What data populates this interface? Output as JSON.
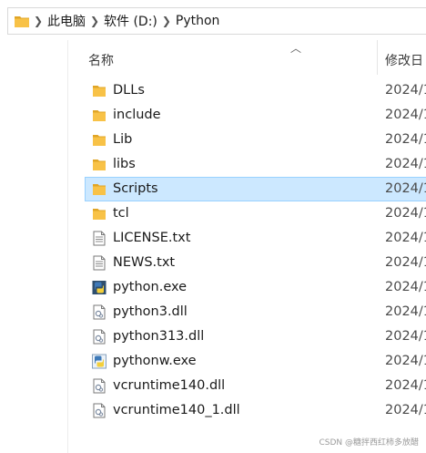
{
  "address": {
    "crumbs": [
      "此电脑",
      "软件 (D:)",
      "Python"
    ]
  },
  "header": {
    "name_label": "名称",
    "date_label": "修改日"
  },
  "files": [
    {
      "name": "DLLs",
      "date": "2024/1",
      "icon": "folder-icon",
      "selected": false
    },
    {
      "name": "include",
      "date": "2024/1",
      "icon": "folder-icon",
      "selected": false
    },
    {
      "name": "Lib",
      "date": "2024/1",
      "icon": "folder-icon",
      "selected": false
    },
    {
      "name": "libs",
      "date": "2024/1",
      "icon": "folder-icon",
      "selected": false
    },
    {
      "name": "Scripts",
      "date": "2024/1",
      "icon": "folder-icon",
      "selected": true
    },
    {
      "name": "tcl",
      "date": "2024/1",
      "icon": "folder-icon",
      "selected": false
    },
    {
      "name": "LICENSE.txt",
      "date": "2024/1",
      "icon": "text-file-icon",
      "selected": false
    },
    {
      "name": "NEWS.txt",
      "date": "2024/1",
      "icon": "text-file-icon",
      "selected": false
    },
    {
      "name": "python.exe",
      "date": "2024/1",
      "icon": "python-exe-icon",
      "selected": false
    },
    {
      "name": "python3.dll",
      "date": "2024/1",
      "icon": "dll-file-icon",
      "selected": false
    },
    {
      "name": "python313.dll",
      "date": "2024/1",
      "icon": "dll-file-icon",
      "selected": false
    },
    {
      "name": "pythonw.exe",
      "date": "2024/1",
      "icon": "pythonw-exe-icon",
      "selected": false
    },
    {
      "name": "vcruntime140.dll",
      "date": "2024/1",
      "icon": "dll-file-icon",
      "selected": false
    },
    {
      "name": "vcruntime140_1.dll",
      "date": "2024/1",
      "icon": "dll-file-icon",
      "selected": false
    }
  ],
  "watermark": "CSDN @糖拌西红柿多放醋",
  "colors": {
    "folder": "#f8c247",
    "folder_dark": "#e0a526",
    "selection_bg": "#cce8ff",
    "selection_border": "#99d1ff"
  }
}
